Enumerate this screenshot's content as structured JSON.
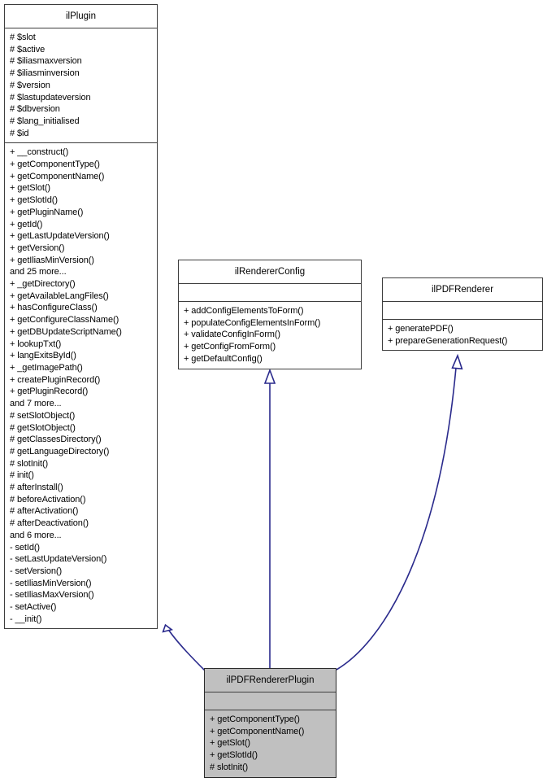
{
  "diagram": {
    "title": "ilPDFRendererPlugin class inheritance diagram",
    "type": "uml-class-diagram",
    "colors": {
      "background": "#ffffff",
      "box_fill": "#ffffff",
      "highlight_fill": "#c0c0c0",
      "border": "#3d3d3d",
      "text": "#000000",
      "edge": "#2a2a8c"
    }
  },
  "classes": {
    "ilPlugin": {
      "name": "ilPlugin",
      "highlighted": false,
      "attributes": [
        "# $slot",
        "# $active",
        "# $iliasmaxversion",
        "# $iliasminversion",
        "# $version",
        "# $lastupdateversion",
        "# $dbversion",
        "# $lang_initialised",
        "# $id"
      ],
      "operations": [
        "+ __construct()",
        "+ getComponentType()",
        "+ getComponentName()",
        "+ getSlot()",
        "+ getSlotId()",
        "+ getPluginName()",
        "+ getId()",
        "+ getLastUpdateVersion()",
        "+ getVersion()",
        "+ getIliasMinVersion()",
        "and 25 more...",
        "+ _getDirectory()",
        "+ getAvailableLangFiles()",
        "+ hasConfigureClass()",
        "+ getConfigureClassName()",
        "+ getDBUpdateScriptName()",
        "+ lookupTxt()",
        "+ langExitsById()",
        "+ _getImagePath()",
        "+ createPluginRecord()",
        "+ getPluginRecord()",
        "and 7 more...",
        "# setSlotObject()",
        "# getSlotObject()",
        "# getClassesDirectory()",
        "# getLanguageDirectory()",
        "# slotInit()",
        "# init()",
        "# afterInstall()",
        "# beforeActivation()",
        "# afterActivation()",
        "# afterDeactivation()",
        "and 6 more...",
        "- setId()",
        "- setLastUpdateVersion()",
        "- setVersion()",
        "- setIliasMinVersion()",
        "- setIliasMaxVersion()",
        "- setActive()",
        "- __init()"
      ]
    },
    "ilRendererConfig": {
      "name": "ilRendererConfig",
      "highlighted": false,
      "attributes": [],
      "operations": [
        "+ addConfigElementsToForm()",
        "+ populateConfigElementsInForm()",
        "+ validateConfigInForm()",
        "+ getConfigFromForm()",
        "+ getDefaultConfig()"
      ]
    },
    "ilPDFRenderer": {
      "name": "ilPDFRenderer",
      "highlighted": false,
      "attributes": [],
      "operations": [
        "+ generatePDF()",
        "+ prepareGenerationRequest()"
      ]
    },
    "ilPDFRendererPlugin": {
      "name": "ilPDFRendererPlugin",
      "highlighted": true,
      "attributes": [],
      "operations": [
        "+ getComponentType()",
        "+ getComponentName()",
        "+ getSlot()",
        "+ getSlotId()",
        "# slotInit()"
      ]
    }
  },
  "relationships": [
    {
      "kind": "generalization",
      "from": "ilPDFRendererPlugin",
      "to": "ilPlugin"
    },
    {
      "kind": "generalization",
      "from": "ilPDFRendererPlugin",
      "to": "ilRendererConfig"
    },
    {
      "kind": "generalization",
      "from": "ilPDFRendererPlugin",
      "to": "ilPDFRenderer"
    }
  ]
}
